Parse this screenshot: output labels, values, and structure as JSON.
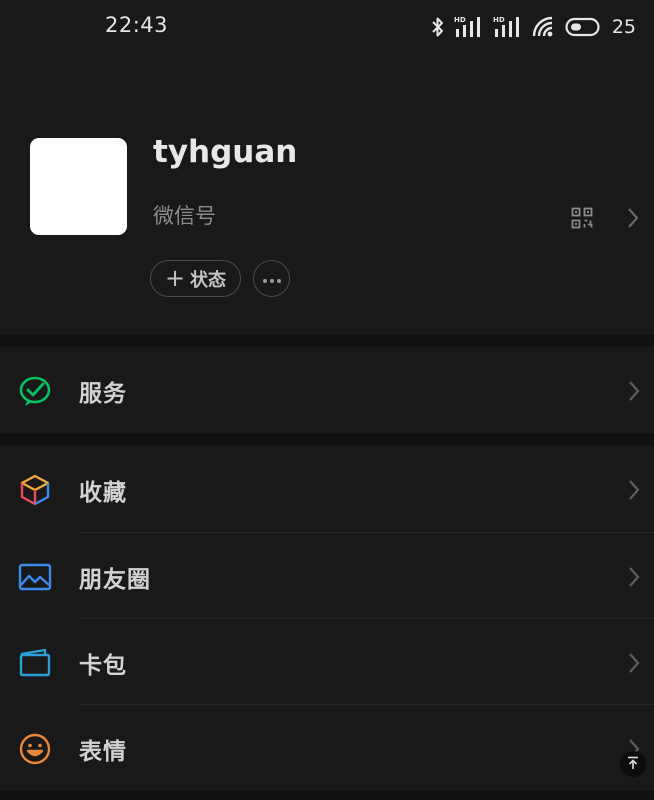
{
  "status_bar": {
    "time": "22:43",
    "battery": "25",
    "icons": [
      "bluetooth-icon",
      "hd-signal-icon",
      "hd-signal-icon",
      "wifi-icon",
      "battery-icon"
    ]
  },
  "profile": {
    "username": "tyhguan",
    "wechat_id_label": "微信号",
    "status_button_label": "状态",
    "icons": [
      "qr-code-icon",
      "chevron-right-icon",
      "plus-icon",
      "more-icon"
    ]
  },
  "menu": {
    "service": {
      "label": "服务",
      "icon": "wechat-pay-icon",
      "color": "#07C160"
    },
    "favorites": {
      "label": "收藏",
      "icon": "cube-icon"
    },
    "moments": {
      "label": "朋友圈",
      "icon": "picture-icon",
      "color": "#3B8BEB"
    },
    "cards": {
      "label": "卡包",
      "icon": "wallet-icon",
      "color": "#2B9FD8"
    },
    "stickers": {
      "label": "表情",
      "icon": "smiley-icon",
      "color": "#E8873A"
    }
  },
  "colors": {
    "background": "#191919",
    "section_gap": "#111111"
  }
}
